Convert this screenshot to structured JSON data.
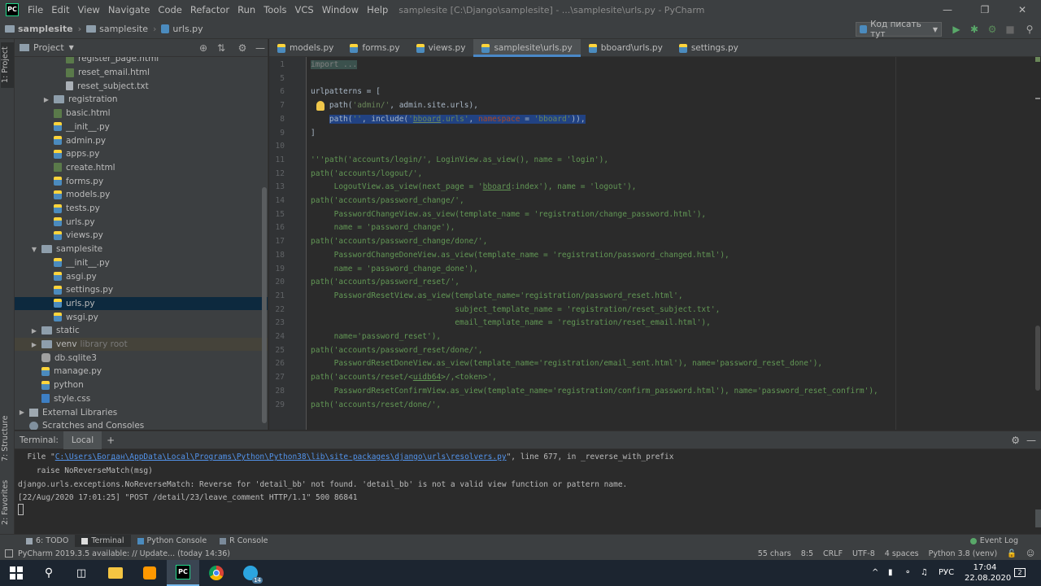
{
  "app": {
    "logo": "PC",
    "menu": [
      "File",
      "Edit",
      "View",
      "Navigate",
      "Code",
      "Refactor",
      "Run",
      "Tools",
      "VCS",
      "Window",
      "Help"
    ],
    "window_title": "samplesite [C:\\Django\\samplesite] - ...\\samplesite\\urls.py - PyCharm"
  },
  "breadcrumbs": [
    "samplesite",
    "samplesite",
    "urls.py"
  ],
  "run_config": "Код писать тут",
  "left_strip": {
    "project": "1: Project",
    "structure": "7: Structure",
    "favorites": "2: Favorites"
  },
  "project_panel": {
    "title": "Project",
    "items": [
      {
        "label": "register_page.html",
        "icon": "html-file-icon",
        "indent": 3
      },
      {
        "label": "reset_email.html",
        "icon": "html-file-icon",
        "indent": 3
      },
      {
        "label": "reset_subject.txt",
        "icon": "text-file-icon",
        "indent": 3
      },
      {
        "label": "registration",
        "icon": "folder-icon",
        "indent": 2,
        "arrow": "▶"
      },
      {
        "label": "basic.html",
        "icon": "html-file-icon",
        "indent": 2
      },
      {
        "label": "__init__.py",
        "icon": "python-file-icon",
        "indent": 2
      },
      {
        "label": "admin.py",
        "icon": "python-file-icon",
        "indent": 2
      },
      {
        "label": "apps.py",
        "icon": "python-file-icon",
        "indent": 2
      },
      {
        "label": "create.html",
        "icon": "html-file-icon",
        "indent": 2
      },
      {
        "label": "forms.py",
        "icon": "python-file-icon",
        "indent": 2
      },
      {
        "label": "models.py",
        "icon": "python-file-icon",
        "indent": 2
      },
      {
        "label": "tests.py",
        "icon": "python-file-icon",
        "indent": 2
      },
      {
        "label": "urls.py",
        "icon": "python-file-icon",
        "indent": 2
      },
      {
        "label": "views.py",
        "icon": "python-file-icon",
        "indent": 2
      },
      {
        "label": "samplesite",
        "icon": "folder-icon",
        "indent": 1,
        "arrow": "▼"
      },
      {
        "label": "__init__.py",
        "icon": "python-file-icon",
        "indent": 2
      },
      {
        "label": "asgi.py",
        "icon": "python-file-icon",
        "indent": 2
      },
      {
        "label": "settings.py",
        "icon": "python-file-icon",
        "indent": 2
      },
      {
        "label": "urls.py",
        "icon": "python-file-icon",
        "indent": 2,
        "selected": true
      },
      {
        "label": "wsgi.py",
        "icon": "python-file-icon",
        "indent": 2
      },
      {
        "label": "static",
        "icon": "folder-icon",
        "indent": 1,
        "arrow": "▶"
      },
      {
        "label": "venv",
        "icon": "folder-icon",
        "indent": 1,
        "arrow": "▶",
        "suffix": "library root",
        "lib": true
      },
      {
        "label": "db.sqlite3",
        "icon": "database-icon",
        "indent": 1
      },
      {
        "label": "manage.py",
        "icon": "python-file-icon",
        "indent": 1
      },
      {
        "label": "python",
        "icon": "python-file-icon",
        "indent": 1
      },
      {
        "label": "style.css",
        "icon": "css-file-icon",
        "indent": 1
      },
      {
        "label": "External Libraries",
        "icon": "library-icon",
        "indent": 0,
        "arrow": "▶"
      },
      {
        "label": "Scratches and Consoles",
        "icon": "scratches-icon",
        "indent": 0
      }
    ]
  },
  "tabs": [
    {
      "label": "models.py",
      "active": false
    },
    {
      "label": "forms.py",
      "active": false
    },
    {
      "label": "views.py",
      "active": false
    },
    {
      "label": "samplesite\\urls.py",
      "active": true
    },
    {
      "label": "bboard\\urls.py",
      "active": false
    },
    {
      "label": "settings.py",
      "active": false
    }
  ],
  "code_lines": [
    {
      "n": "1",
      "html": "<span class=\"fold\">import ...</span>"
    },
    {
      "n": "5",
      "html": ""
    },
    {
      "n": "6",
      "html": "urlpatterns = ["
    },
    {
      "n": "7",
      "html": "    path(<span class=\"s\">'admin/'</span>, admin.site.urls),"
    },
    {
      "n": "8",
      "html": "    <span class=\"hl\">path(<span class=\"s\">''</span>, include(<span class=\"s\">'<span class=\"und\">bboard</span>.urls'</span>, <span class=\"kw\">namespace</span> = <span class=\"s\">'bboard'</span>)),</span>"
    },
    {
      "n": "9",
      "html": "]"
    },
    {
      "n": "10",
      "html": ""
    },
    {
      "n": "11",
      "html": "<span class=\"gr\">'''path('accounts/login/', LoginView.as_view(), name = 'login'),</span>"
    },
    {
      "n": "12",
      "html": "<span class=\"gr\">path('accounts/logout/',</span>"
    },
    {
      "n": "13",
      "html": "<span class=\"gr\">     LogoutView.as_view(next_page = '<span class=\"und\">bboard</span>:index'), name = 'logout'),</span>"
    },
    {
      "n": "14",
      "html": "<span class=\"gr\">path('accounts/password_change/',</span>"
    },
    {
      "n": "15",
      "html": "<span class=\"gr\">     PasswordChangeView.as_view(template_name = 'registration/change_password.html'),</span>"
    },
    {
      "n": "16",
      "html": "<span class=\"gr\">     name = 'password_change'),</span>"
    },
    {
      "n": "17",
      "html": "<span class=\"gr\">path('accounts/password_change/done/',</span>"
    },
    {
      "n": "18",
      "html": "<span class=\"gr\">     PasswordChangeDoneView.as_view(template_name = 'registration/password_changed.html'),</span>"
    },
    {
      "n": "19",
      "html": "<span class=\"gr\">     name = 'password_change_done'),</span>"
    },
    {
      "n": "20",
      "html": "<span class=\"gr\">path('accounts/password_reset/',</span>"
    },
    {
      "n": "21",
      "html": "<span class=\"gr\">     PasswordResetView.as_view(template_name='registration/password_reset.html',</span>"
    },
    {
      "n": "22",
      "html": "<span class=\"gr\">                               subject_template_name = 'registration/reset_subject.txt',</span>"
    },
    {
      "n": "23",
      "html": "<span class=\"gr\">                               email_template_name = 'registration/reset_email.html'),</span>"
    },
    {
      "n": "24",
      "html": "<span class=\"gr\">     name='password_reset'),</span>"
    },
    {
      "n": "25",
      "html": "<span class=\"gr\">path('accounts/password_reset/done/',</span>"
    },
    {
      "n": "26",
      "html": "<span class=\"gr\">     PasswordResetDoneView.as_view(template_name='registration/email_sent.html'), name='password_reset_done'),</span>"
    },
    {
      "n": "27",
      "html": "<span class=\"gr\">path('accounts/reset/&lt;<span class=\"und\">uidb64</span>&gt;/,&lt;token&gt;',</span>"
    },
    {
      "n": "28",
      "html": "<span class=\"gr\">     PasswordResetConfirmView.as_view(template_name='registration/confirm_password.html'), name='password_reset_confirm'),</span>"
    },
    {
      "n": "29",
      "html": "<span class=\"gr\">path('accounts/reset/done/',</span>"
    }
  ],
  "terminal": {
    "label": "Terminal:",
    "tab": "Local",
    "line1_prefix": "  File \"",
    "line1_link": "C:\\Users\\Богдан\\AppData\\Local\\Programs\\Python\\Python38\\lib\\site-packages\\django\\urls\\resolvers.py",
    "line1_suffix": "\", line 677, in _reverse_with_prefix",
    "line2": "    raise NoReverseMatch(msg)",
    "line3": "django.urls.exceptions.NoReverseMatch: Reverse for 'detail_bb' not found. 'detail_bb' is not a valid view function or pattern name.",
    "line4": "[22/Aug/2020 17:01:25] \"POST /detail/23/leave_comment HTTP/1.1\" 500 86841"
  },
  "bottom_tabs": [
    "6: TODO",
    "Terminal",
    "Python Console",
    "R Console"
  ],
  "event_log": "Event Log",
  "status": {
    "message": "PyCharm 2019.3.5 available: // Update... (today 14:36)",
    "chars": "55 chars",
    "position": "8:5",
    "line_sep": "CRLF",
    "encoding": "UTF-8",
    "indent": "4 spaces",
    "interpreter": "Python 3.8 (venv)"
  },
  "taskbar": {
    "lang": "РУС",
    "time": "17:04",
    "date": "22.08.2020",
    "notif": "2",
    "telegram_badge": "14"
  }
}
